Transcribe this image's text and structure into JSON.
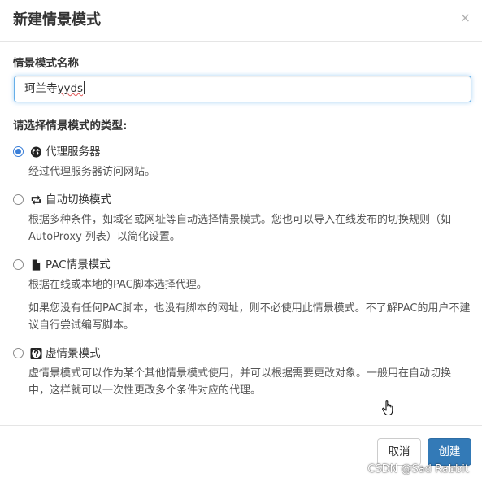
{
  "dialog": {
    "title": "新建情景模式",
    "close_symbol": "×"
  },
  "name_field": {
    "label": "情景模式名称",
    "value_prefix": "珂兰寺",
    "value_misspelled": "yyds"
  },
  "type_section": {
    "label": "请选择情景模式的类型:",
    "options": [
      {
        "icon": "globe-icon",
        "label": "代理服务器",
        "selected": true,
        "descriptions": [
          "经过代理服务器访问网站。"
        ]
      },
      {
        "icon": "switch-icon",
        "label": "自动切换模式",
        "selected": false,
        "descriptions": [
          "根据多种条件，如域名或网址等自动选择情景模式。您也可以导入在线发布的切换规则（如 AutoProxy 列表）以简化设置。"
        ]
      },
      {
        "icon": "file-icon",
        "label": "PAC情景模式",
        "selected": false,
        "descriptions": [
          "根据在线或本地的PAC脚本选择代理。",
          "如果您没有任何PAC脚本，也没有脚本的网址，则不必使用此情景模式。不了解PAC的用户不建议自行尝试编写脚本。"
        ]
      },
      {
        "icon": "question-icon",
        "label": "虚情景模式",
        "selected": false,
        "descriptions": [
          "虚情景模式可以作为某个其他情景模式使用，并可以根据需要更改对象。一般用在自动切换中，这样就可以一次性更改多个条件对应的代理。"
        ]
      }
    ]
  },
  "footer": {
    "cancel_label": "取消",
    "create_label": "创建"
  },
  "watermark": "CSDN @Sad Rabbit",
  "colors": {
    "primary": "#337ab7",
    "radio_selected": "#3b7fd8",
    "input_focus": "#66afe9"
  }
}
